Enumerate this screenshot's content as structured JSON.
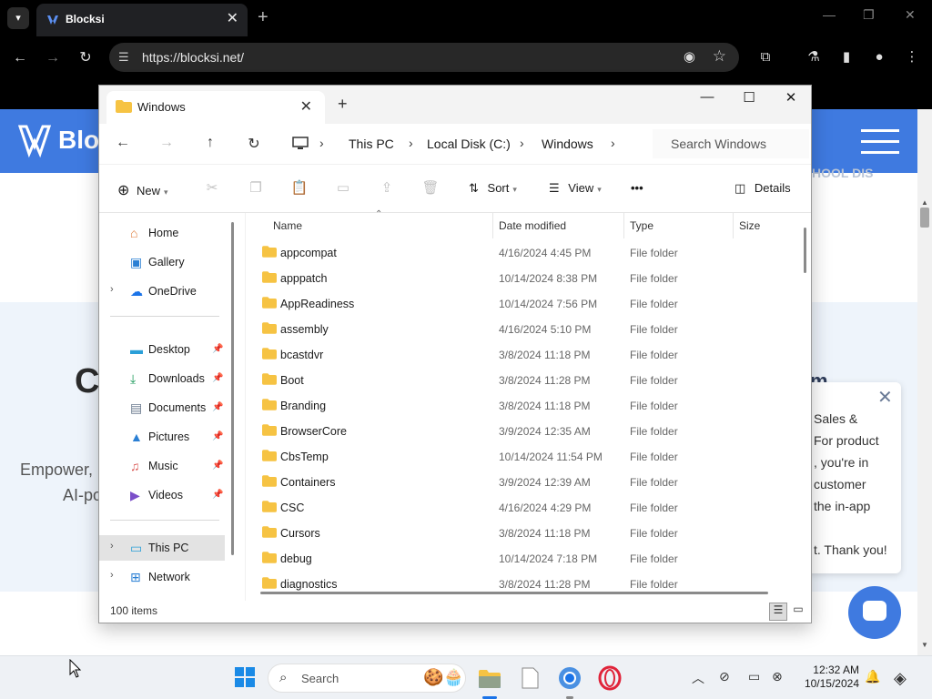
{
  "browser": {
    "tab_title": "Blocksi",
    "url": "https://blocksi.net/",
    "new_tab_symbol": "+"
  },
  "website": {
    "logo_text": "Blocl",
    "ghost_header_text": "HOOL DIS",
    "hero_letter": "C",
    "hero_mark": "m",
    "hero_line1": "Empower,",
    "hero_line2": "AI-po",
    "chat_popup_lines": [
      "Sales &",
      "For product",
      ", you're in",
      "customer",
      "the in-app",
      "t. Thank you!"
    ]
  },
  "explorer": {
    "tab_label": "Windows",
    "breadcrumbs": [
      "This PC",
      "Local Disk (C:)",
      "Windows"
    ],
    "search_placeholder": "Search Windows",
    "commands": {
      "new": "New",
      "sort": "Sort",
      "view": "View",
      "more": "•••",
      "details": "Details"
    },
    "nav": {
      "home": "Home",
      "gallery": "Gallery",
      "onedrive": "OneDrive",
      "desktop": "Desktop",
      "downloads": "Downloads",
      "documents": "Documents",
      "pictures": "Pictures",
      "music": "Music",
      "videos": "Videos",
      "this_pc": "This PC",
      "network": "Network"
    },
    "columns": {
      "name": "Name",
      "date": "Date modified",
      "type": "Type",
      "size": "Size"
    },
    "files": [
      {
        "name": "appcompat",
        "date": "4/16/2024 4:45 PM",
        "type": "File folder"
      },
      {
        "name": "apppatch",
        "date": "10/14/2024 8:38 PM",
        "type": "File folder"
      },
      {
        "name": "AppReadiness",
        "date": "10/14/2024 7:56 PM",
        "type": "File folder"
      },
      {
        "name": "assembly",
        "date": "4/16/2024 5:10 PM",
        "type": "File folder"
      },
      {
        "name": "bcastdvr",
        "date": "3/8/2024 11:18 PM",
        "type": "File folder"
      },
      {
        "name": "Boot",
        "date": "3/8/2024 11:28 PM",
        "type": "File folder"
      },
      {
        "name": "Branding",
        "date": "3/8/2024 11:18 PM",
        "type": "File folder"
      },
      {
        "name": "BrowserCore",
        "date": "3/9/2024 12:35 AM",
        "type": "File folder"
      },
      {
        "name": "CbsTemp",
        "date": "10/14/2024 11:54 PM",
        "type": "File folder"
      },
      {
        "name": "Containers",
        "date": "3/9/2024 12:39 AM",
        "type": "File folder"
      },
      {
        "name": "CSC",
        "date": "4/16/2024 4:29 PM",
        "type": "File folder"
      },
      {
        "name": "Cursors",
        "date": "3/8/2024 11:18 PM",
        "type": "File folder"
      },
      {
        "name": "debug",
        "date": "10/14/2024 7:18 PM",
        "type": "File folder"
      },
      {
        "name": "diagnostics",
        "date": "3/8/2024 11:28 PM",
        "type": "File folder"
      }
    ],
    "status_count": "100 items"
  },
  "taskbar": {
    "search_label": "Search",
    "time": "12:32 AM",
    "date": "10/15/2024"
  },
  "colors": {
    "blocksi_blue": "#3f7ae0",
    "folder_yellow": "#f6c343",
    "chrome_dark": "#000000"
  }
}
